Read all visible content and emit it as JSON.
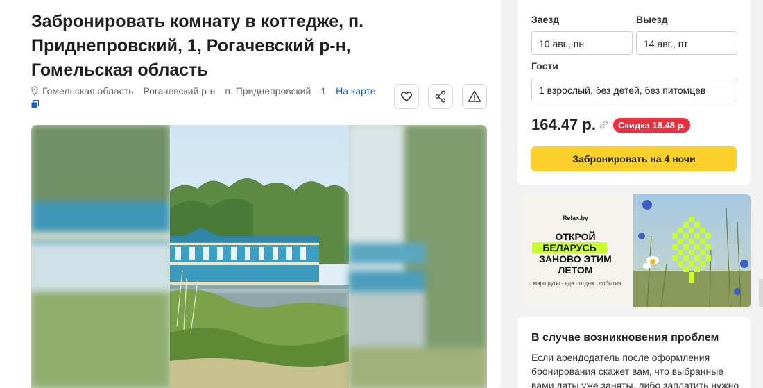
{
  "listing": {
    "title": "Забронировать комнату в коттедже, п. Приднепровский, 1, Рогачевский р-н, Гомельская область",
    "address": {
      "region": "Гомельская область",
      "district": "Рогачевский р-н",
      "settlement": "п. Приднепровский",
      "house": "1",
      "map_link": "На карте"
    },
    "actions": {
      "favorite_icon": "heart-icon",
      "share_icon": "share-icon",
      "report_icon": "warning-icon"
    }
  },
  "booking": {
    "checkin_label": "Заезд",
    "checkin_value": "10 авг., пн",
    "checkout_label": "Выезд",
    "checkout_value": "14 авг., пт",
    "guests_label": "Гости",
    "guests_value": "1 взрослый, без детей, без питомцев",
    "price": "164.47 р.",
    "discount": "Скидка 18.48 р.",
    "book_button": "Забронировать на 4 ночи"
  },
  "banner": {
    "logo": "Relax.by",
    "line1": "ОТКРОЙ",
    "line2": "БЕЛАРУСЬ",
    "line3": "ЗАНОВО ЭТИМ",
    "line4": "ЛЕТОМ",
    "tagline": "· маршруты · еда · отдых · события"
  },
  "problems": {
    "title": "В случае возникновения проблем",
    "text": "Если арендодатель после оформления бронирования скажет вам, что выбранные вами даты уже заняты, либо заплатить нужно"
  },
  "colors": {
    "accent_yellow": "#fcd02b",
    "discount_red": "#e8303f",
    "link_blue": "#1a5ec7",
    "banner_highlight": "#c7ff2e"
  }
}
